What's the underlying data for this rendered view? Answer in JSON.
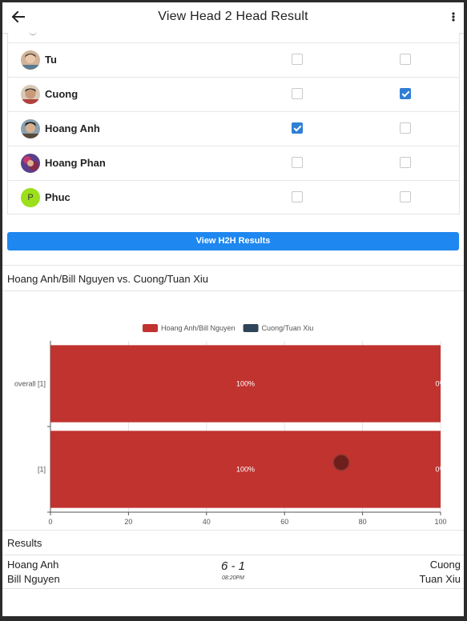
{
  "header": {
    "title": "View Head 2 Head Result",
    "back_icon": "arrow-left-icon",
    "menu_icon": "more-vertical-icon"
  },
  "players": [
    {
      "name": "Tu",
      "team1": false,
      "team2": false,
      "avatar_color": "#8a6d57"
    },
    {
      "name": "Cuong",
      "team1": false,
      "team2": true,
      "avatar_color": "#b0413e"
    },
    {
      "name": "Hoang Anh",
      "team1": true,
      "team2": false,
      "avatar_color": "#5a4a3a"
    },
    {
      "name": "Hoang Phan",
      "team1": false,
      "team2": false,
      "avatar_color": "#7a2a6a"
    },
    {
      "name": "Phuc",
      "team1": false,
      "team2": false,
      "avatar_color": "#9be01a",
      "avatar_initial": "P"
    }
  ],
  "button": {
    "label": "View H2H Results"
  },
  "matchup": {
    "title": "Hoang Anh/Bill Nguyen vs. Cuong/Tuan Xiu"
  },
  "chart_data": {
    "type": "bar",
    "orientation": "horizontal",
    "stacked": true,
    "categories": [
      "overall [1]",
      "[1]"
    ],
    "series": [
      {
        "name": "Hoang Anh/Bill Nguyen",
        "values": [
          100,
          100
        ],
        "color": "#c0332f"
      },
      {
        "name": "Cuong/Tuan Xiu",
        "values": [
          0,
          0
        ],
        "color": "#2f4558"
      }
    ],
    "xlim": [
      0,
      100
    ],
    "xticks": [
      0,
      20,
      40,
      60,
      80,
      100
    ],
    "legend_position": "top",
    "grid": true
  },
  "results": {
    "label": "Results",
    "matches": [
      {
        "team1": [
          "Hoang Anh",
          "Bill Nguyen"
        ],
        "team2": [
          "Cuong",
          "Tuan Xiu"
        ],
        "score": "6 - 1",
        "time": "08:20PM"
      }
    ]
  },
  "colors": {
    "accent": "#1e87f0",
    "checkbox": "#2f7fd6"
  }
}
